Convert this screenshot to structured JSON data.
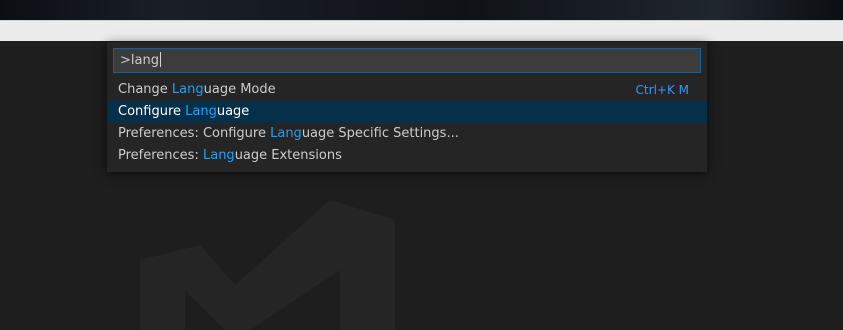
{
  "palette": {
    "input_value": ">lang",
    "items": [
      {
        "before": "Change ",
        "match": "Lang",
        "after": "uage Mode",
        "keybinding": "Ctrl+K M",
        "selected": false
      },
      {
        "before": "Configure ",
        "match": "Lang",
        "after": "uage",
        "keybinding": "",
        "selected": true
      },
      {
        "before": "Preferences: Configure ",
        "match": "Lang",
        "after": "uage Specific Settings...",
        "keybinding": "",
        "selected": false
      },
      {
        "before": "Preferences: ",
        "match": "Lang",
        "after": "uage Extensions",
        "keybinding": "",
        "selected": false
      }
    ]
  },
  "colors": {
    "highlight": "#18a3ff",
    "selection": "#062f4a",
    "focus_border": "#0e639c",
    "keybinding": "#3794ff"
  },
  "icons": {
    "watermark": "vscode-logo-watermark-icon"
  }
}
